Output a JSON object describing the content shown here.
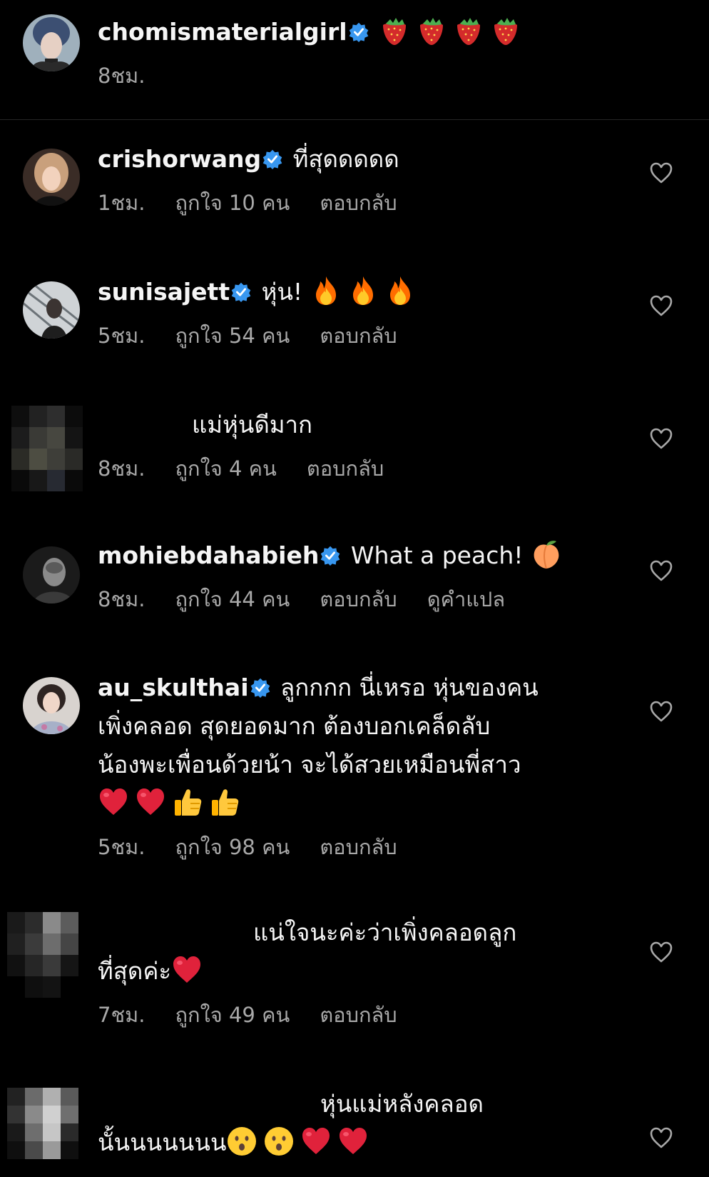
{
  "caption": {
    "username": "chomismaterialgirl",
    "text": "",
    "emoji": [
      "strawberry-emoji",
      "strawberry-emoji",
      "strawberry-emoji",
      "strawberry-emoji"
    ],
    "time": "8ชม."
  },
  "comments": [
    {
      "username": "crishorwang",
      "text": "ที่สุดดดดด",
      "time": "1ชม.",
      "likes": "ถูกใจ 10 คน",
      "reply": "ตอบกลับ"
    },
    {
      "username": "sunisajett",
      "text": "หุ่น!",
      "time": "5ชม.",
      "likes": "ถูกใจ 54 คน",
      "reply": "ตอบกลับ",
      "emoji": [
        "fire-emoji",
        "fire-emoji",
        "fire-emoji"
      ]
    },
    {
      "username": "",
      "text": "แม่หุ่นดีมาก",
      "time": "8ชม.",
      "likes": "ถูกใจ 4 คน",
      "reply": "ตอบกลับ"
    },
    {
      "username": "mohiebdahabieh",
      "text": "What a peach!",
      "time": "8ชม.",
      "likes": "ถูกใจ 44 คน",
      "reply": "ตอบกลับ",
      "translate": "ดูคำแปล",
      "emoji": [
        "peach-emoji"
      ]
    },
    {
      "username": "au_skulthai",
      "line1": "ลูกกกก นี่เหรอ หุ่นของคน",
      "line2": "เพิ่งคลอด สุดยอดมาก ต้องบอกเคล็ดลับ",
      "line3": "น้องพะเพื่อนด้วยน้า จะได้สวยเหมือนพี่สาว",
      "time": "5ชม.",
      "likes": "ถูกใจ 98 คน",
      "reply": "ตอบกลับ",
      "emoji": [
        "red-heart-emoji",
        "red-heart-emoji",
        "thumbs-up-emoji",
        "thumbs-up-emoji"
      ]
    },
    {
      "username": "",
      "line1": "แน่ใจนะค่ะว่าเพิ่งคลอดลูก",
      "line2": "ที่สุดค่ะ",
      "time": "7ชม.",
      "likes": "ถูกใจ 49 คน",
      "reply": "ตอบกลับ",
      "emoji": [
        "red-heart-emoji"
      ]
    },
    {
      "username": "",
      "line1": "หุ่นแม่หลังคลอด",
      "line2": "นั้นนนนนนน",
      "emoji": [
        "hushed-face-emoji",
        "hushed-face-emoji",
        "red-heart-emoji",
        "red-heart-emoji"
      ]
    }
  ],
  "colors": {
    "background": "#000000",
    "text": "#f5f5f5",
    "secondary": "#a8a8a8",
    "verified": "#3897f0",
    "divider": "#262626"
  }
}
